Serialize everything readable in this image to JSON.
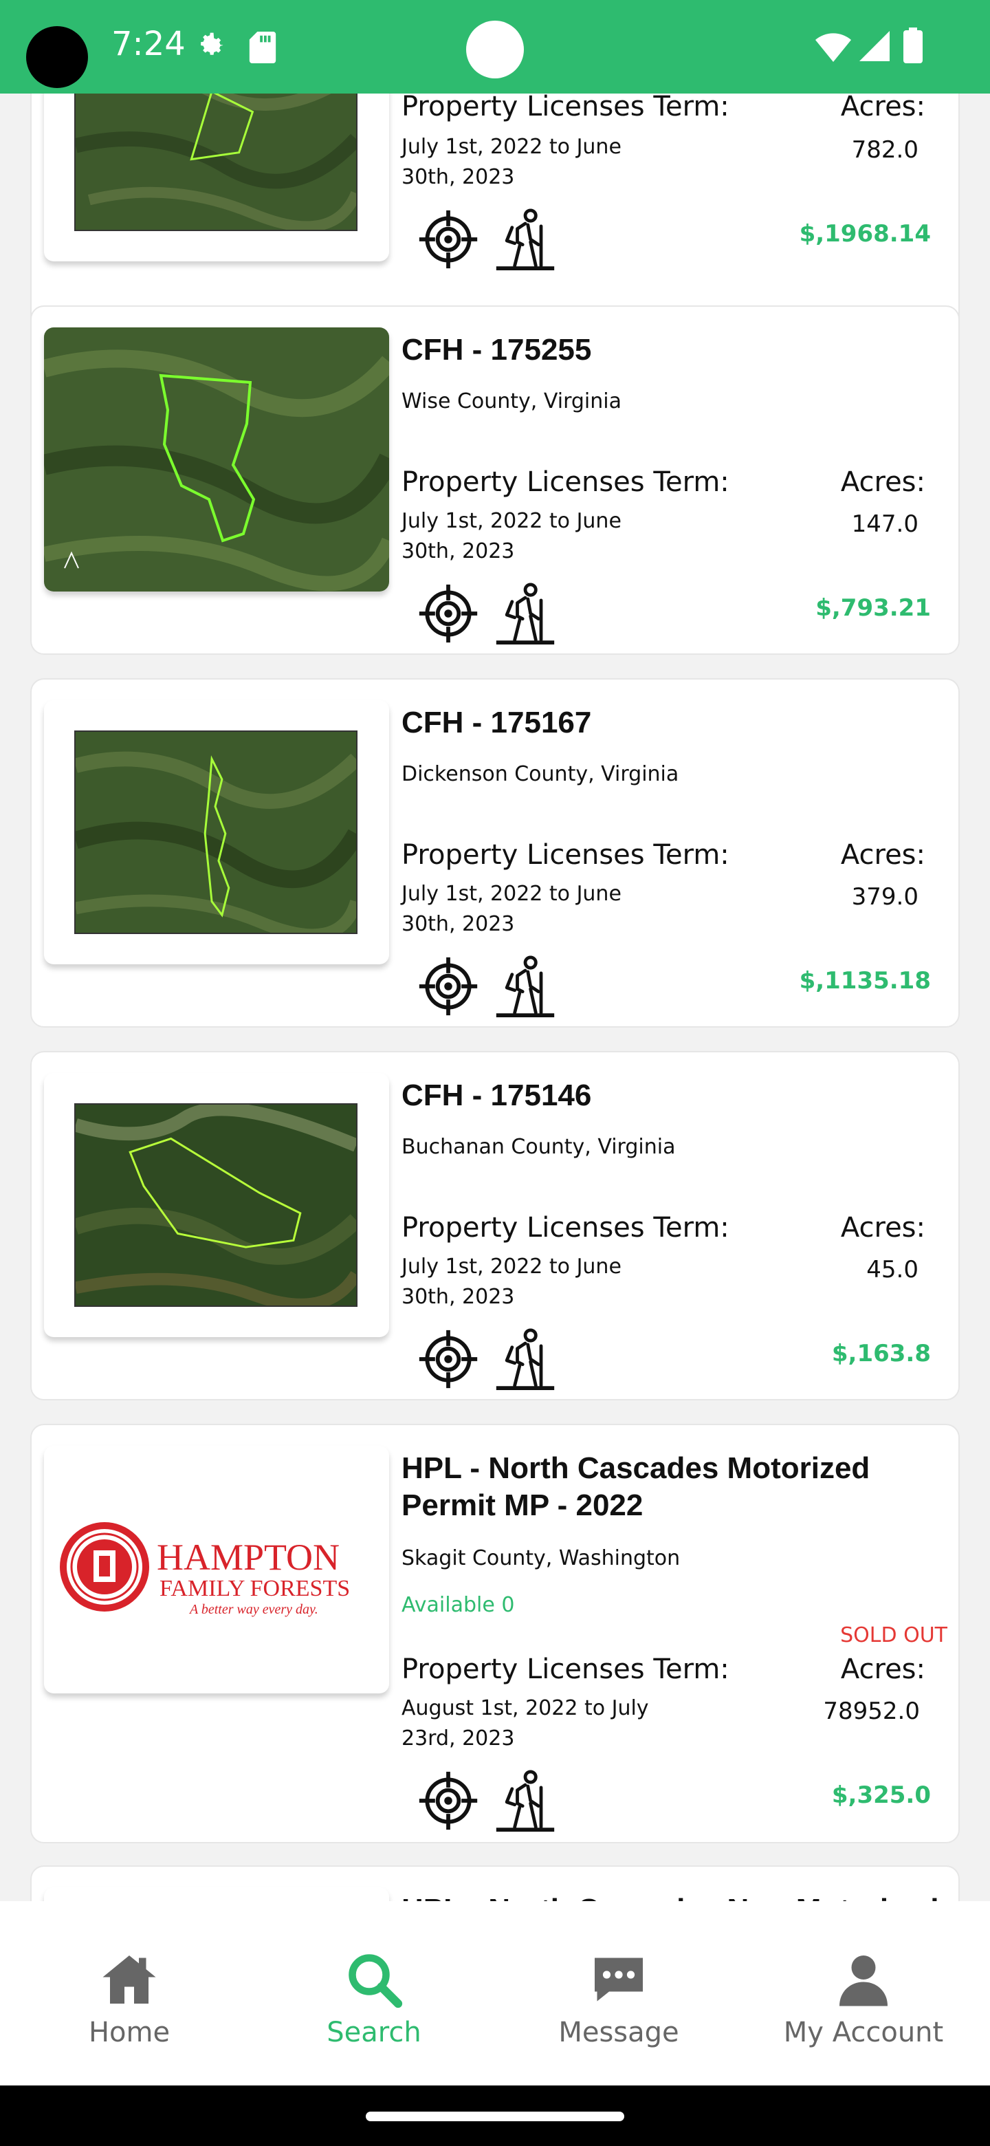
{
  "status_bar": {
    "time": "7:24",
    "icons": [
      "settings-gear-icon",
      "sd-card-icon",
      "wifi-icon",
      "signal-icon",
      "battery-icon"
    ]
  },
  "listings": [
    {
      "title": "",
      "county": "",
      "term_label": "Property Licenses Term:",
      "term_dates": "July 1st, 2022 to June 30th, 2023",
      "acres_label": "Acres:",
      "acres": "782.0",
      "price": "$,1968.14"
    },
    {
      "title": "CFH - 175255",
      "county": "Wise County, Virginia",
      "term_label": "Property Licenses Term:",
      "term_dates": "July 1st, 2022 to June 30th, 2023",
      "acres_label": "Acres:",
      "acres": "147.0",
      "price": "$,793.21"
    },
    {
      "title": "CFH - 175167",
      "county": "Dickenson County, Virginia",
      "term_label": "Property Licenses Term:",
      "term_dates": "July 1st, 2022 to June 30th, 2023",
      "acres_label": "Acres:",
      "acres": "379.0",
      "price": "$,1135.18"
    },
    {
      "title": "CFH - 175146",
      "county": "Buchanan County, Virginia",
      "term_label": "Property Licenses Term:",
      "term_dates": "July 1st, 2022 to June 30th, 2023",
      "acres_label": "Acres:",
      "acres": "45.0",
      "price": "$,163.8"
    },
    {
      "title": "HPL - North Cascades Motorized Permit MP - 2022",
      "county": "Skagit County, Washington",
      "availability": "Available 0",
      "status": "SOLD OUT",
      "term_label": "Property Licenses Term:",
      "term_dates": "August 1st, 2022 to July 23rd, 2023",
      "acres_label": "Acres:",
      "acres": "78952.0",
      "price": "$,325.0",
      "logo": {
        "name_line1": "HAMPTON",
        "name_line2": "FAMILY FORESTS",
        "tagline": "A better way every day."
      }
    },
    {
      "title": "HPL - North Cascades Non-Motorized"
    }
  ],
  "activity_icons": [
    "crosshair-hunting-icon",
    "hiker-icon"
  ],
  "bottom_nav": {
    "items": [
      {
        "label": "Home",
        "icon": "home-icon",
        "active": false
      },
      {
        "label": "Search",
        "icon": "search-icon",
        "active": true
      },
      {
        "label": "Message",
        "icon": "message-icon",
        "active": false
      },
      {
        "label": "My Account",
        "icon": "account-icon",
        "active": false
      }
    ]
  },
  "colors": {
    "accent": "#2ebb6f",
    "sold_out": "#e53935",
    "logo_red": "#d8232a"
  }
}
